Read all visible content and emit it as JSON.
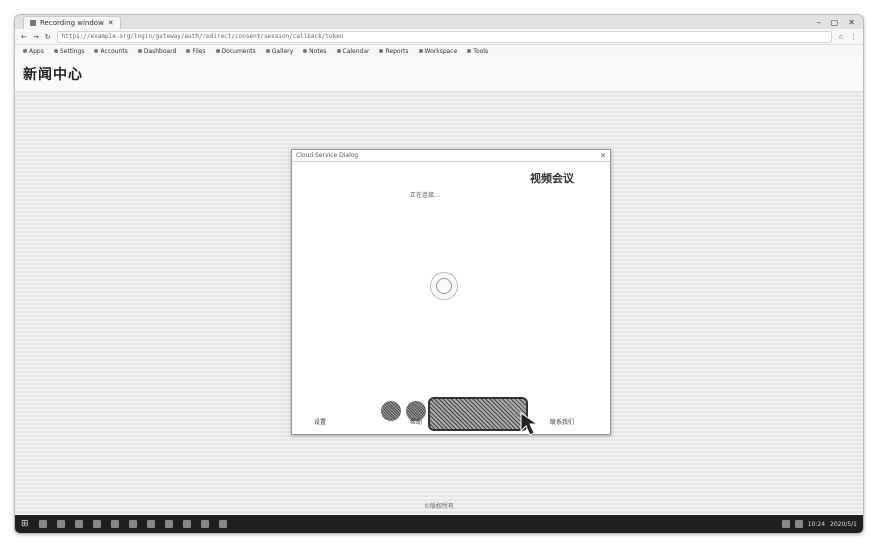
{
  "browser": {
    "tab_title": "Recording window",
    "address": "https://example.org/login/gateway/auth/redirect/consent/session/callback/token",
    "bookmarks": [
      "Apps",
      "Settings",
      "Accounts",
      "Dashboard",
      "Files",
      "Documents",
      "Gallery",
      "Notes",
      "Calendar",
      "Reports",
      "Workspace",
      "Tools"
    ],
    "window_controls": [
      "–",
      "▢",
      "✕"
    ]
  },
  "page": {
    "site_logo": "新闻中心",
    "footer_text": "©版权所有"
  },
  "dialog": {
    "title": "Cloud Service Dialog",
    "close": "✕",
    "heading": "视频会议",
    "subtitle": "正在连接…",
    "footer_left": "设置",
    "footer_mid": "帮助",
    "footer_right": "联系我们"
  },
  "taskbar": {
    "time": "10:24",
    "date": "2020/5/1"
  },
  "icons": {
    "spinner": "loading-spinner-icon",
    "cursor": "arrow-cursor-icon"
  }
}
